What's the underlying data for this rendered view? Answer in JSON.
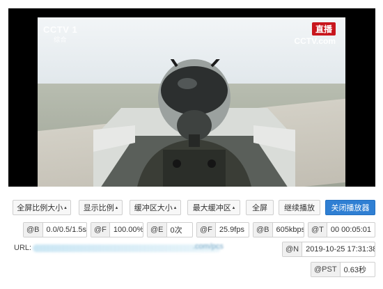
{
  "video": {
    "channel_logo": "CCTV 1",
    "channel_logo_sub": "综合",
    "live_badge": "直播",
    "live_site": "CCTV.com"
  },
  "controls": {
    "fullscreen_ratio": "全屏比例大小",
    "display_ratio": "显示比例",
    "buffer_size": "缓冲区大小",
    "max_buffer": "最大缓冲区",
    "fullscreen": "全屏",
    "continue_play": "继续播放",
    "close_player": "关闭播放器",
    "caret": "▴"
  },
  "stats": {
    "b1": {
      "key": "@B",
      "value": "0.0/0.5/1.5s"
    },
    "f1": {
      "key": "@F",
      "value": "100.00%"
    },
    "e": {
      "key": "@E",
      "value": "0次"
    },
    "f2": {
      "key": "@F",
      "value": "25.9fps"
    },
    "b2": {
      "key": "@B",
      "value": "605kbps"
    },
    "t": {
      "key": "@T",
      "value": "00 00:05:01"
    },
    "n": {
      "key": "@N",
      "value": "2019-10-25 17:31:38"
    },
    "pst": {
      "key": "@PST",
      "value": "0.63秒"
    }
  },
  "url": {
    "label": "URL:",
    "visible_fragment": ".com/pcs"
  },
  "colors": {
    "primary_button": "#2f7fd3",
    "live_red": "#c8161d"
  }
}
